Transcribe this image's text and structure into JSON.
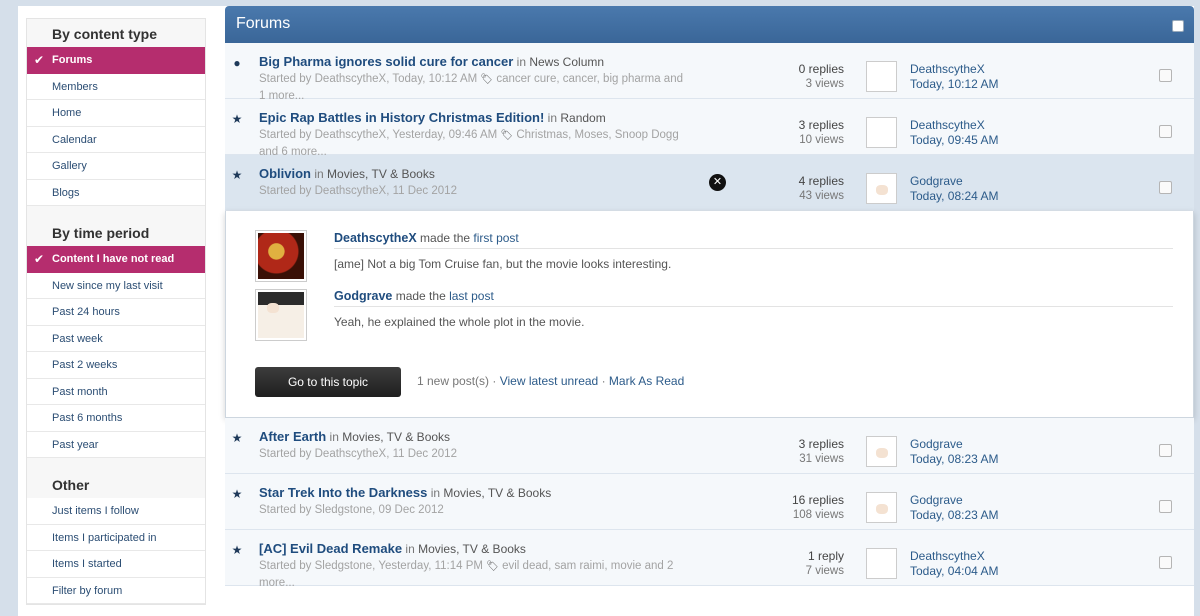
{
  "sidebar": {
    "sections": [
      {
        "heading": "By content type",
        "items": [
          {
            "label": "Forums",
            "active": true
          },
          {
            "label": "Members",
            "active": false
          },
          {
            "label": "Home",
            "active": false
          },
          {
            "label": "Calendar",
            "active": false
          },
          {
            "label": "Gallery",
            "active": false
          },
          {
            "label": "Blogs",
            "active": false
          }
        ]
      },
      {
        "heading": "By time period",
        "items": [
          {
            "label": "Content I have not read",
            "active": true
          },
          {
            "label": "New since my last visit",
            "active": false
          },
          {
            "label": "Past 24 hours",
            "active": false
          },
          {
            "label": "Past week",
            "active": false
          },
          {
            "label": "Past 2 weeks",
            "active": false
          },
          {
            "label": "Past month",
            "active": false
          },
          {
            "label": "Past 6 months",
            "active": false
          },
          {
            "label": "Past year",
            "active": false
          }
        ]
      },
      {
        "heading": "Other",
        "items": [
          {
            "label": "Just items I follow",
            "active": false
          },
          {
            "label": "Items I participated in",
            "active": false
          },
          {
            "label": "Items I started",
            "active": false
          },
          {
            "label": "Filter by forum",
            "active": false
          }
        ]
      }
    ]
  },
  "main": {
    "title": "Forums",
    "topics": [
      {
        "marker": "dot-icon",
        "title": "Big Pharma ignores solid cure for cancer",
        "in": "in",
        "forum": "News Column",
        "started": "Started by DeathscytheX, Today, 10:12 AM",
        "tags": "cancer cure, cancer, big pharma",
        "more": "and 1 more...",
        "replies": "0 replies",
        "views": "3 views",
        "last_user": "DeathscytheX",
        "last_time": "Today, 10:12 AM",
        "avatar": "red"
      },
      {
        "marker": "star-icon",
        "title": "Epic Rap Battles in History Christmas Edition!",
        "in": "in",
        "forum": "Random",
        "started": "Started by DeathscytheX, Yesterday, 09:46 AM",
        "tags": "Christmas, Moses, Snoop",
        "more": "Dogg and 6 more...",
        "replies": "3 replies",
        "views": "10 views",
        "last_user": "DeathscytheX",
        "last_time": "Today, 09:45 AM",
        "avatar": "red"
      },
      {
        "marker": "star-icon",
        "title": "Oblivion",
        "in": "in",
        "forum": "Movies, TV & Books",
        "started": "Started by DeathscytheX, 11 Dec 2012",
        "tags": "",
        "more": "",
        "replies": "4 replies",
        "views": "43 views",
        "last_user": "Godgrave",
        "last_time": "Today, 08:24 AM",
        "avatar": "anime"
      }
    ],
    "preview": {
      "first_user": "DeathscytheX",
      "made_the": "made the",
      "first_post": "first post",
      "first_text": "[ame] Not a big Tom Cruise fan, but the movie looks interesting.",
      "last_user": "Godgrave",
      "last_post": "last post",
      "last_text": "Yeah, he explained the whole plot in the movie.",
      "button": "Go to this topic",
      "new_posts": "1 new post(s) ·",
      "view_latest": "View latest unread",
      "sep": "·",
      "mark_read": "Mark As Read"
    },
    "topics_after": [
      {
        "marker": "star-icon",
        "title": "After Earth",
        "in": "in",
        "forum": "Movies, TV & Books",
        "started": "Started by DeathscytheX, 11 Dec 2012",
        "tags": "",
        "more": "",
        "replies": "3 replies",
        "views": "31 views",
        "last_user": "Godgrave",
        "last_time": "Today, 08:23 AM",
        "avatar": "anime"
      },
      {
        "marker": "star-icon",
        "title": "Star Trek Into the Darkness",
        "in": "in",
        "forum": "Movies, TV & Books",
        "started": "Started by Sledgstone, 09 Dec 2012",
        "tags": "",
        "more": "",
        "replies": "16 replies",
        "views": "108 views",
        "last_user": "Godgrave",
        "last_time": "Today, 08:23 AM",
        "avatar": "anime"
      },
      {
        "marker": "star-icon",
        "title": "[AC] Evil Dead Remake",
        "in": "in",
        "forum": "Movies, TV & Books",
        "started": "Started by Sledgstone, Yesterday, 11:14 PM",
        "tags": "evil dead, sam raimi, movie",
        "more": "and 2 more...",
        "replies": "1 reply",
        "views": "7 views",
        "last_user": "DeathscytheX",
        "last_time": "Today, 04:04 AM",
        "avatar": "red"
      }
    ]
  },
  "colors": {
    "active_item": "#b52d6e",
    "header": "#3f6c9f",
    "link": "#1f4c7e"
  }
}
